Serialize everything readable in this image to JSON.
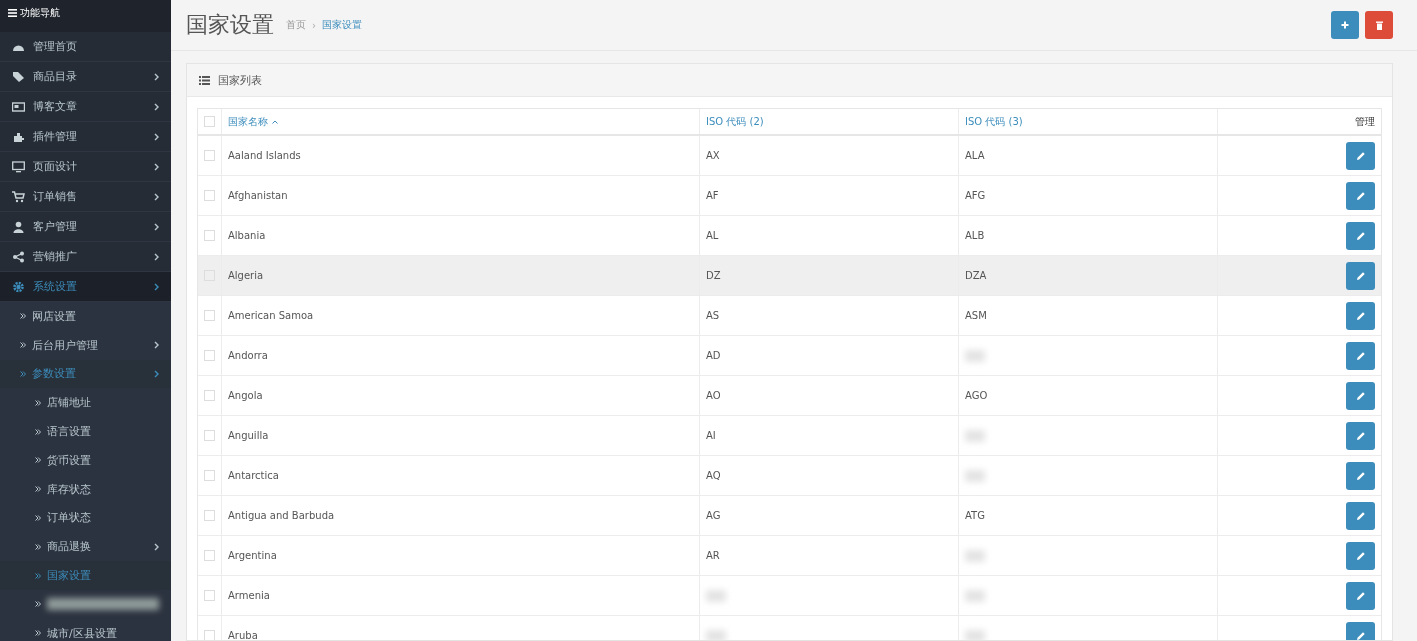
{
  "sidebar": {
    "title": "功能导航",
    "items": [
      {
        "label": "管理首页",
        "has_children": false,
        "active": false
      },
      {
        "label": "商品目录",
        "has_children": true,
        "active": false
      },
      {
        "label": "博客文章",
        "has_children": true,
        "active": false
      },
      {
        "label": "插件管理",
        "has_children": true,
        "active": false
      },
      {
        "label": "页面设计",
        "has_children": true,
        "active": false
      },
      {
        "label": "订单销售",
        "has_children": true,
        "active": false
      },
      {
        "label": "客户管理",
        "has_children": true,
        "active": false
      },
      {
        "label": "营销推广",
        "has_children": true,
        "active": false
      },
      {
        "label": "系统设置",
        "has_children": true,
        "active": true,
        "children": [
          {
            "label": "网店设置",
            "has_children": false,
            "active": false
          },
          {
            "label": "后台用户管理",
            "has_children": true,
            "active": false
          },
          {
            "label": "参数设置",
            "has_children": true,
            "active": true,
            "children": [
              {
                "label": "店铺地址",
                "has_children": false,
                "active": false
              },
              {
                "label": "语言设置",
                "has_children": false,
                "active": false
              },
              {
                "label": "货币设置",
                "has_children": false,
                "active": false
              },
              {
                "label": "库存状态",
                "has_children": false,
                "active": false
              },
              {
                "label": "订单状态",
                "has_children": false,
                "active": false
              },
              {
                "label": "商品退换",
                "has_children": true,
                "active": false
              },
              {
                "label": "国家设置",
                "has_children": false,
                "active": true
              },
              {
                "redacted": true,
                "has_children": false,
                "active": false
              },
              {
                "label": "城市/区县设置",
                "has_children": false,
                "active": false
              }
            ]
          }
        ]
      }
    ]
  },
  "header": {
    "title": "国家设置",
    "separator": "›",
    "breadcrumb": [
      {
        "label": "首页",
        "current": false
      },
      {
        "label": "国家设置",
        "current": true
      }
    ]
  },
  "panel": {
    "title": "国家列表"
  },
  "table": {
    "select_all_checked": false,
    "columns": [
      {
        "label": "国家名称",
        "sorted": true
      },
      {
        "label": "ISO 代码 (2)",
        "sorted": false
      },
      {
        "label": "ISO 代码 (3)",
        "sorted": false
      },
      {
        "label": "管理",
        "sorted": false
      }
    ],
    "rows": [
      {
        "name": "Aaland Islands",
        "iso2": {
          "text": "AX"
        },
        "iso3": {
          "text": "ALA"
        },
        "hover": false,
        "checked": false
      },
      {
        "name": "Afghanistan",
        "iso2": {
          "text": "AF"
        },
        "iso3": {
          "text": "AFG"
        },
        "hover": false,
        "checked": false
      },
      {
        "name": "Albania",
        "iso2": {
          "text": "AL"
        },
        "iso3": {
          "text": "ALB"
        },
        "hover": false,
        "checked": false
      },
      {
        "name": "Algeria",
        "iso2": {
          "text": "DZ"
        },
        "iso3": {
          "text": "DZA"
        },
        "hover": true,
        "checked": false
      },
      {
        "name": "American Samoa",
        "iso2": {
          "text": "AS"
        },
        "iso3": {
          "text": "ASM"
        },
        "hover": false,
        "checked": false
      },
      {
        "name": "Andorra",
        "iso2": {
          "text": "AD"
        },
        "iso3": {
          "redacted": true
        },
        "hover": false,
        "checked": false
      },
      {
        "name": "Angola",
        "iso2": {
          "text": "AO"
        },
        "iso3": {
          "text": "AGO"
        },
        "hover": false,
        "checked": false
      },
      {
        "name": "Anguilla",
        "iso2": {
          "text": "AI"
        },
        "iso3": {
          "redacted": true
        },
        "hover": false,
        "checked": false
      },
      {
        "name": "Antarctica",
        "iso2": {
          "text": "AQ"
        },
        "iso3": {
          "redacted": true
        },
        "hover": false,
        "checked": false
      },
      {
        "name": "Antigua and Barbuda",
        "iso2": {
          "text": "AG"
        },
        "iso3": {
          "text": "ATG"
        },
        "hover": false,
        "checked": false
      },
      {
        "name": "Argentina",
        "iso2": {
          "text": "AR"
        },
        "iso3": {
          "redacted": true
        },
        "hover": false,
        "checked": false
      },
      {
        "name": "Armenia",
        "iso2": {
          "redacted": true
        },
        "iso3": {
          "redacted": true
        },
        "hover": false,
        "checked": false
      },
      {
        "name": "Aruba",
        "iso2": {
          "redacted": true
        },
        "iso3": {
          "redacted": true
        },
        "hover": false,
        "checked": false
      }
    ]
  }
}
